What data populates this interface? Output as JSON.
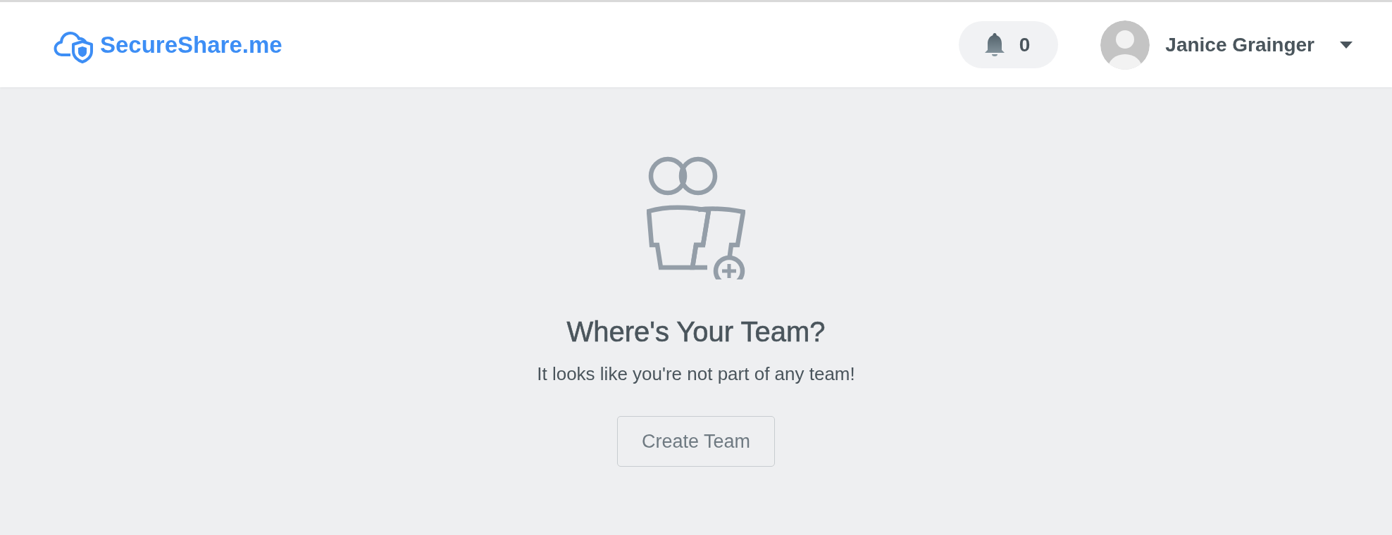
{
  "header": {
    "brand": "SecureShare.me",
    "notifications": {
      "count": "0"
    },
    "user": {
      "name": "Janice Grainger"
    }
  },
  "empty_state": {
    "title": "Where's Your Team?",
    "message": "It looks like you're not part of any team!",
    "button": "Create Team"
  }
}
